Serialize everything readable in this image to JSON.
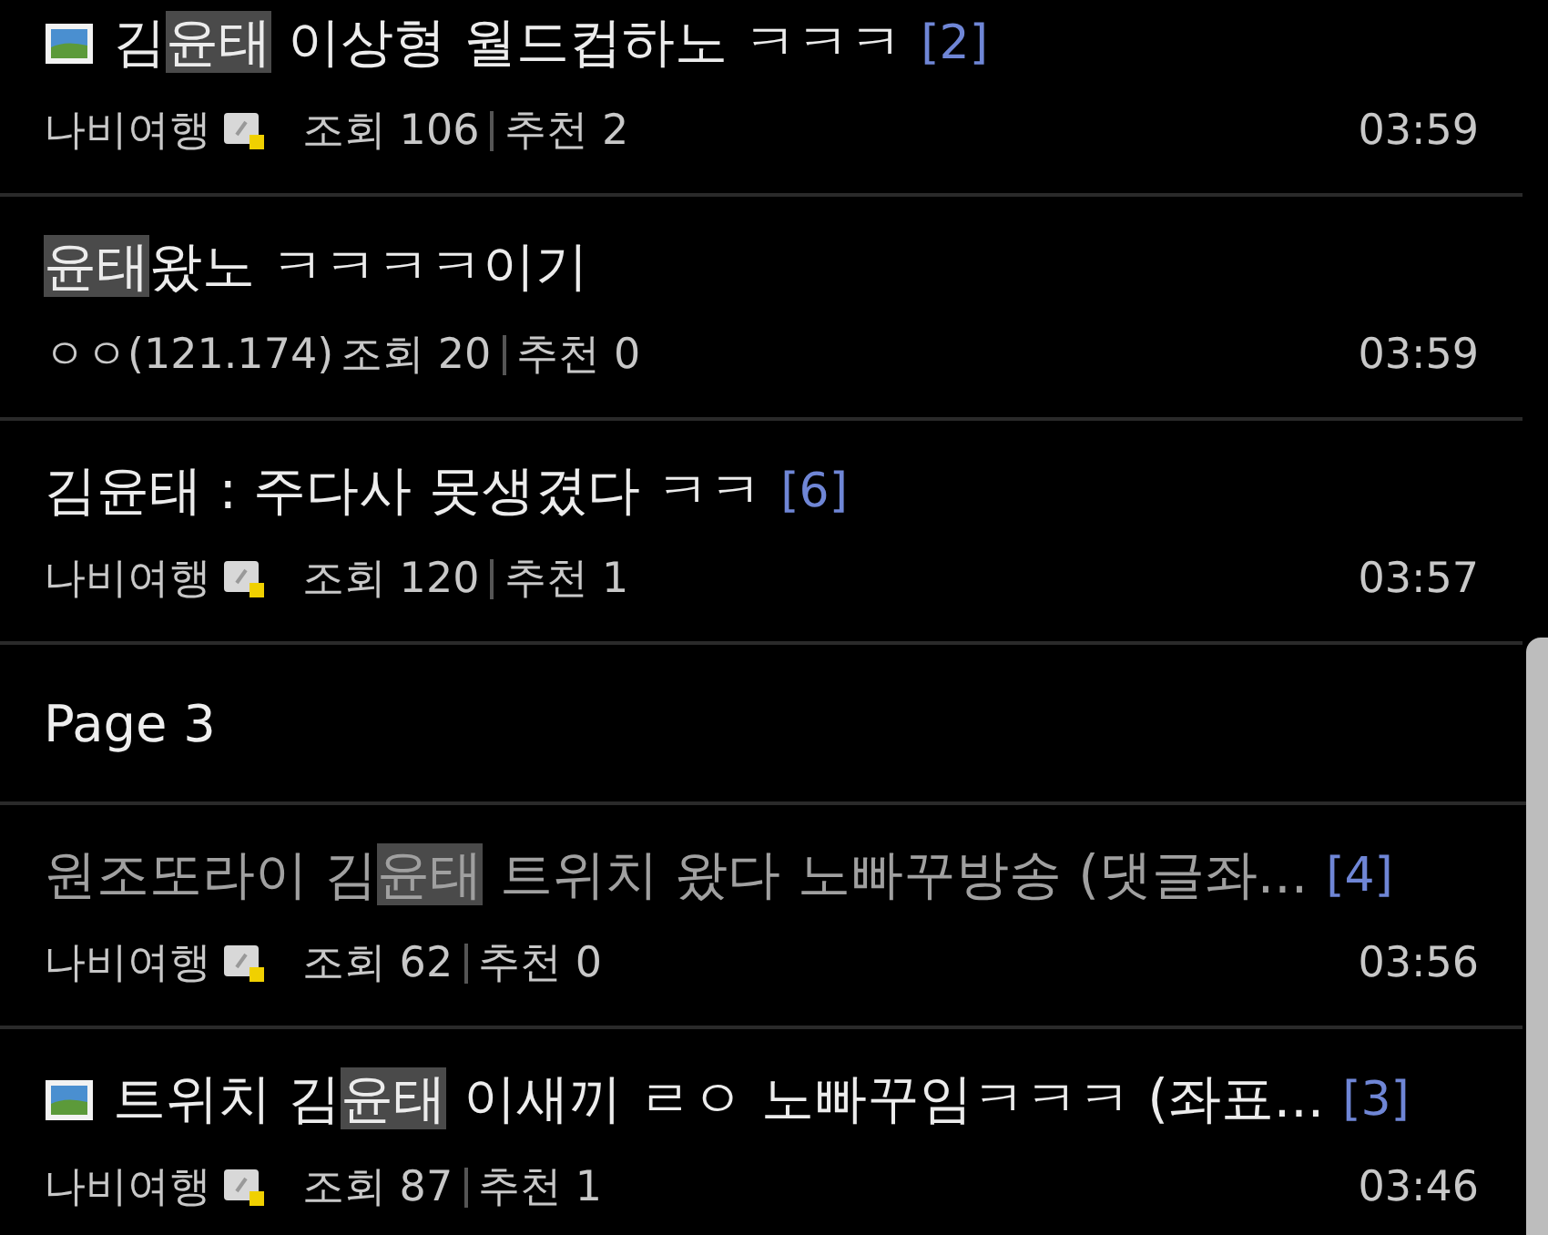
{
  "entries": [
    {
      "kind": "post",
      "has_image": true,
      "read": false,
      "title": [
        {
          "text": "김",
          "highlighted": false
        },
        {
          "text": "윤태",
          "highlighted": true
        },
        {
          "text": " 이상형 월드컵하노 ㅋㅋㅋ",
          "highlighted": false
        }
      ],
      "comments": "[2]",
      "author": "나비여행",
      "member_icon": true,
      "views": "조회 106",
      "likes": "추천 2",
      "time": "03:59"
    },
    {
      "kind": "post",
      "has_image": false,
      "read": false,
      "title": [
        {
          "text": "윤태",
          "highlighted": true
        },
        {
          "text": "왔노 ㅋㅋㅋㅋ이기",
          "highlighted": false
        }
      ],
      "author": "ㅇㅇ(121.174)",
      "member_icon": false,
      "views": "조회 20",
      "likes": "추천 0",
      "time": "03:59"
    },
    {
      "kind": "post",
      "has_image": false,
      "read": false,
      "title": [
        {
          "text": "김윤태 : 주다사 못생겼다 ㅋㅋ",
          "highlighted": false
        }
      ],
      "comments": "[6]",
      "author": "나비여행",
      "member_icon": true,
      "views": "조회 120",
      "likes": "추천 1",
      "time": "03:57"
    },
    {
      "kind": "page",
      "label": "Page 3"
    },
    {
      "kind": "post",
      "has_image": false,
      "read": true,
      "title": [
        {
          "text": "원조또라이 김",
          "highlighted": false
        },
        {
          "text": "윤태",
          "highlighted": true
        },
        {
          "text": " 트위치 왔다 노빠꾸방송 (댓글좌...",
          "highlighted": false
        }
      ],
      "comments": "[4]",
      "author": "나비여행",
      "member_icon": true,
      "views": "조회 62",
      "likes": "추천 0",
      "time": "03:56"
    },
    {
      "kind": "post",
      "has_image": true,
      "read": false,
      "title": [
        {
          "text": "트위치 김",
          "highlighted": false
        },
        {
          "text": "윤태",
          "highlighted": true
        },
        {
          "text": " 이새끼 ㄹㅇ 노빠꾸임ㅋㅋㅋ (좌표...",
          "highlighted": false
        }
      ],
      "comments": "[3]",
      "author": "나비여행",
      "member_icon": true,
      "views": "조회 87",
      "likes": "추천 1",
      "time": "03:46"
    }
  ]
}
